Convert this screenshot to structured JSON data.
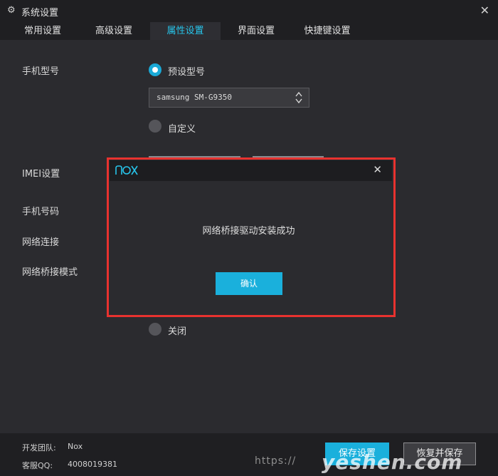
{
  "titlebar": {
    "title": "系统设置",
    "gear_icon": "⚙",
    "close_icon": "✕"
  },
  "tabs": [
    {
      "label": "常用设置"
    },
    {
      "label": "高级设置"
    },
    {
      "label": "属性设置",
      "active": true
    },
    {
      "label": "界面设置"
    },
    {
      "label": "快捷键设置"
    }
  ],
  "properties": {
    "phone_model_label": "手机型号",
    "preset_model_label": "预设型号",
    "model_select_value": "samsung SM-G9350",
    "custom_label": "自定义",
    "imei_label": "IMEI设置",
    "phone_number_label": "手机号码",
    "network_label": "网络连接",
    "bridge_mode_label": "网络桥接模式",
    "off_label": "关闭"
  },
  "footer": {
    "team_label": "开发团队:",
    "team_value": "Nox",
    "qq_label": "客服QQ:",
    "qq_value": "4008019381",
    "save_label": "保存设置",
    "restore_label": "恢复并保存",
    "watermark_url": "https://",
    "watermark_logo": "yeshen.com"
  },
  "dialog": {
    "logo_text": "nox",
    "close_icon": "✕",
    "message": "网络桥接驱动安装成功",
    "confirm_label": "确认"
  },
  "colors": {
    "accent": "#1ab0dc",
    "active_tab_text": "#27c4ea",
    "highlight_border": "#e8322f",
    "background": "#2b2b2f",
    "bar": "#1f1f22"
  }
}
